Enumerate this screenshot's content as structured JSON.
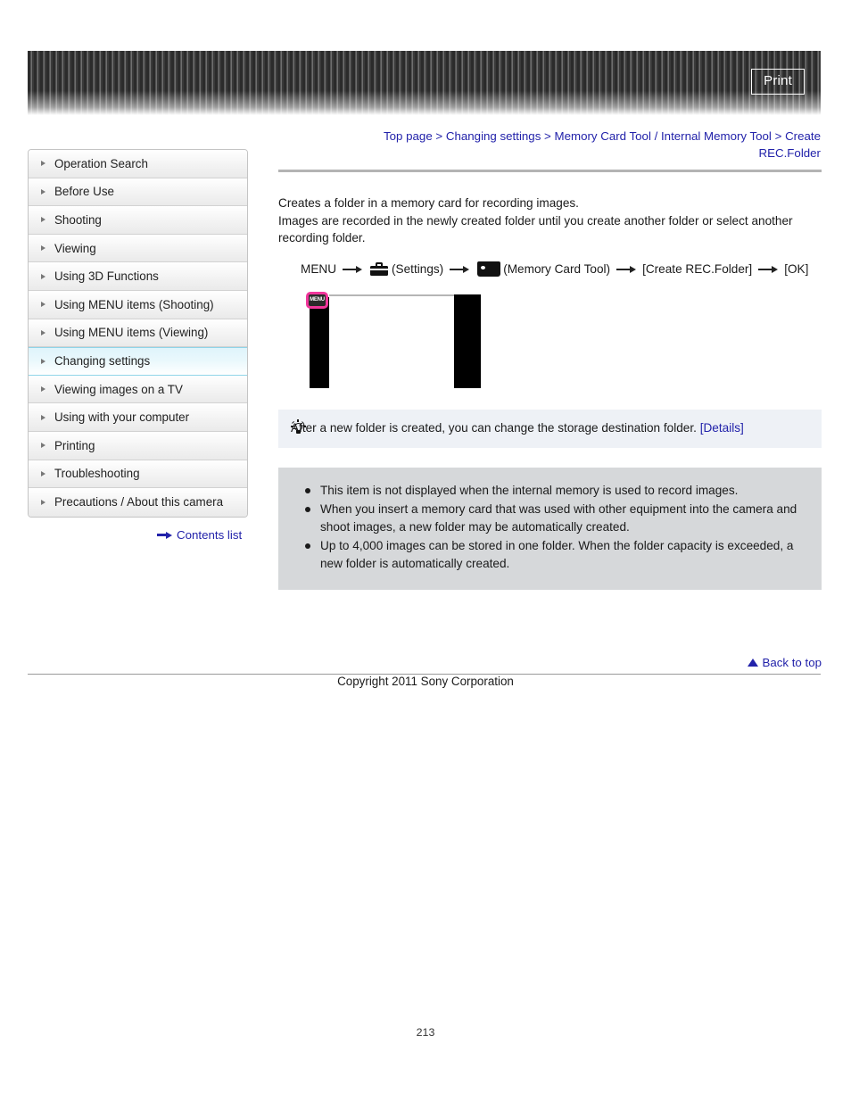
{
  "header": {
    "print_label": "Print"
  },
  "breadcrumb": {
    "items": [
      "Top page",
      "Changing settings",
      "Memory Card Tool / Internal Memory Tool",
      "Create REC.Folder"
    ],
    "separator": ">",
    "full_text": "Top page > Changing settings > Memory Card Tool / Internal Memory Tool > Create REC.Folder"
  },
  "sidebar": {
    "items": [
      {
        "label": "Operation Search",
        "active": false
      },
      {
        "label": "Before Use",
        "active": false
      },
      {
        "label": "Shooting",
        "active": false
      },
      {
        "label": "Viewing",
        "active": false
      },
      {
        "label": "Using 3D Functions",
        "active": false
      },
      {
        "label": "Using MENU items (Shooting)",
        "active": false
      },
      {
        "label": "Using MENU items (Viewing)",
        "active": false
      },
      {
        "label": "Changing settings",
        "active": true
      },
      {
        "label": "Viewing images on a TV",
        "active": false
      },
      {
        "label": "Using with your computer",
        "active": false
      },
      {
        "label": "Printing",
        "active": false
      },
      {
        "label": "Troubleshooting",
        "active": false
      },
      {
        "label": "Precautions / About this camera",
        "active": false
      }
    ],
    "contents_link": "Contents list"
  },
  "main": {
    "intro_line_1": "Creates a folder in a memory card for recording images.",
    "intro_line_2": "Images are recorded in the newly created folder until you create another folder or select another recording folder.",
    "menu_path": {
      "start": "MENU",
      "settings_label": "(Settings)",
      "memory_card_label": "(Memory Card Tool)",
      "create_label": "[Create REC.Folder]",
      "ok_label": "[OK]"
    },
    "figure": {
      "menu_badge_text": "MENU"
    },
    "tip": {
      "text": "After a new folder is created, you can change the storage destination folder.",
      "link_label": "[Details]"
    },
    "notes": [
      "This item is not displayed when the internal memory is used to record images.",
      "When you insert a memory card that was used with other equipment into the camera and shoot images, a new folder may be automatically created.",
      "Up to 4,000 images can be stored in one folder. When the folder capacity is exceeded, a new folder is automatically created."
    ]
  },
  "footer": {
    "back_to_top": "Back to top",
    "copyright": "Copyright 2011 Sony Corporation",
    "page_number": "213"
  },
  "colors": {
    "link": "#2222aa",
    "active_nav": "#dff4fb",
    "tip_bg": "#eef1f6",
    "notes_bg": "#d6d8da",
    "highlight_pink": "#f0369b"
  }
}
